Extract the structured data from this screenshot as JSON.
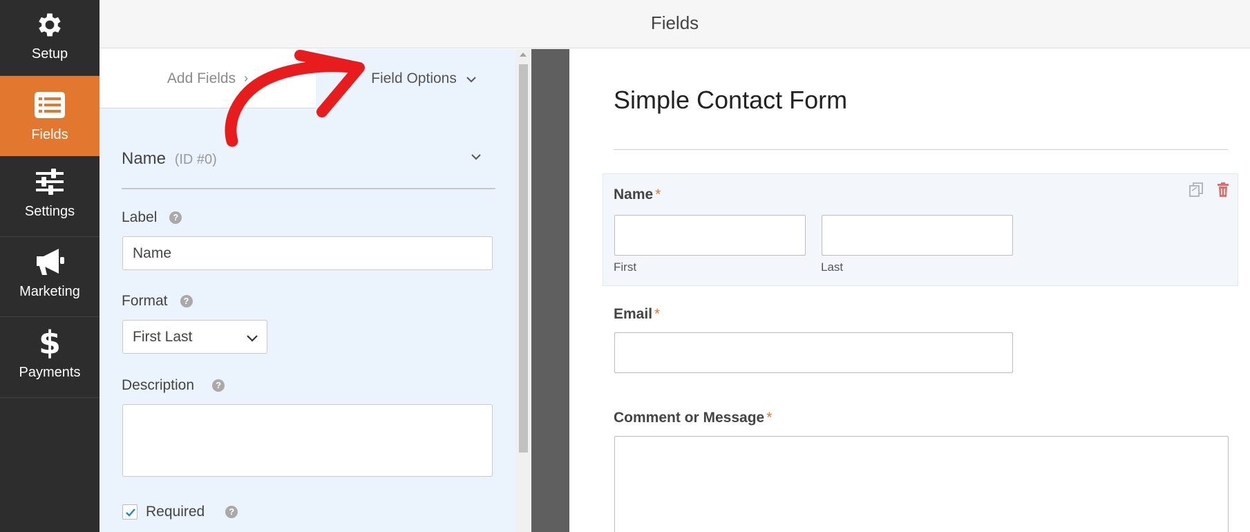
{
  "sidebar": {
    "items": [
      {
        "label": "Setup",
        "icon": "gear-icon"
      },
      {
        "label": "Fields",
        "icon": "list-icon"
      },
      {
        "label": "Settings",
        "icon": "sliders-icon"
      },
      {
        "label": "Marketing",
        "icon": "megaphone-icon"
      },
      {
        "label": "Payments",
        "icon": "dollar-icon"
      }
    ],
    "active": "Fields",
    "colors": {
      "background": "#2d2d2d",
      "active": "#e27730"
    }
  },
  "header": {
    "title": "Fields"
  },
  "panel": {
    "tabs": [
      {
        "label": "Add Fields",
        "chevron": "›"
      },
      {
        "label": "Field Options",
        "chevron": "⌄"
      }
    ],
    "field": {
      "name": "Name",
      "id": "(ID #0)"
    },
    "options": {
      "label_title": "Label",
      "label_value": "Name",
      "format_title": "Format",
      "format_value": "First Last",
      "description_title": "Description",
      "description_value": "",
      "required_label": "Required",
      "required_checked": true,
      "help": "?"
    }
  },
  "preview": {
    "title": "Simple Contact Form",
    "fields": [
      {
        "label": "Name",
        "required": "*",
        "sub": [
          "First",
          "Last"
        ]
      },
      {
        "label": "Email",
        "required": "*"
      },
      {
        "label": "Comment or Message",
        "required": "*"
      }
    ],
    "actions": [
      "duplicate-icon",
      "trash-icon"
    ]
  }
}
